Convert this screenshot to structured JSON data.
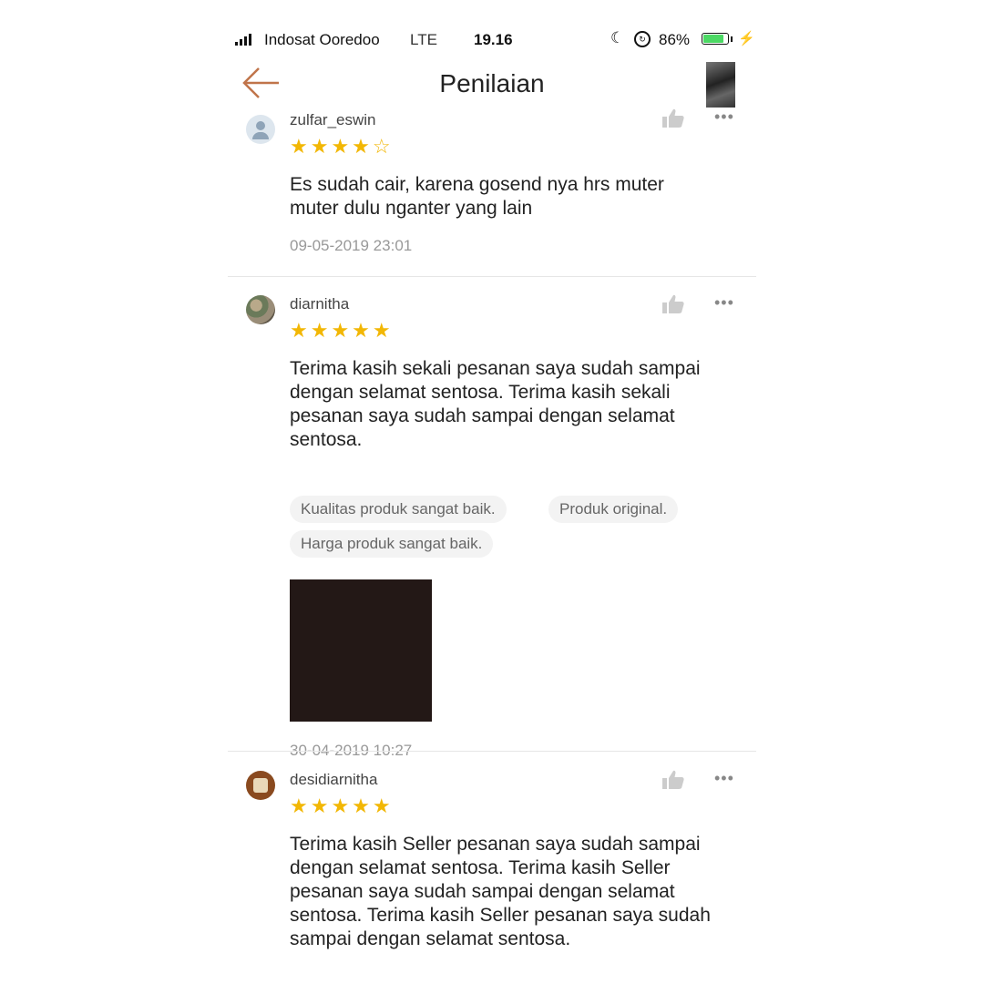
{
  "status_bar": {
    "carrier": "Indosat Ooredoo",
    "network": "LTE",
    "time": "19.16",
    "battery": "86%",
    "battery_level": 0.86
  },
  "header": {
    "title": "Penilaian"
  },
  "reviews": [
    {
      "username": "zulfar_eswin",
      "rating": 4,
      "stars_filled": "★★★★",
      "stars_empty": "☆",
      "text_lines": [
        "Es sudah cair, karena gosend nya hrs muter",
        "muter dulu nganter yang lain"
      ],
      "date": "09-05-2019 23:01"
    },
    {
      "username": "diarnitha",
      "rating": 5,
      "stars_filled": "★★★★★",
      "text_lines": [
        "Terima kasih sekali pesanan saya sudah sampai",
        "dengan selamat sentosa. Terima kasih sekali",
        "pesanan saya sudah sampai dengan selamat",
        "sentosa."
      ],
      "tags": [
        "Kualitas produk sangat baik.",
        "Produk original.",
        "Harga produk sangat baik."
      ],
      "date": "30-04-2019 10:27"
    },
    {
      "username": "desidiarnitha",
      "rating": 5,
      "stars_filled": "★★★★★",
      "text_lines": [
        "Terima kasih Seller pesanan saya sudah sampai",
        "dengan selamat sentosa. Terima kasih Seller",
        "pesanan saya sudah sampai dengan selamat",
        "sentosa. Terima kasih Seller pesanan saya sudah",
        "sampai dengan selamat sentosa."
      ]
    }
  ],
  "more_icon": "•••",
  "colors": {
    "star": "#f2b705",
    "back_arrow": "#c0744a",
    "battery": "#4cd964"
  }
}
